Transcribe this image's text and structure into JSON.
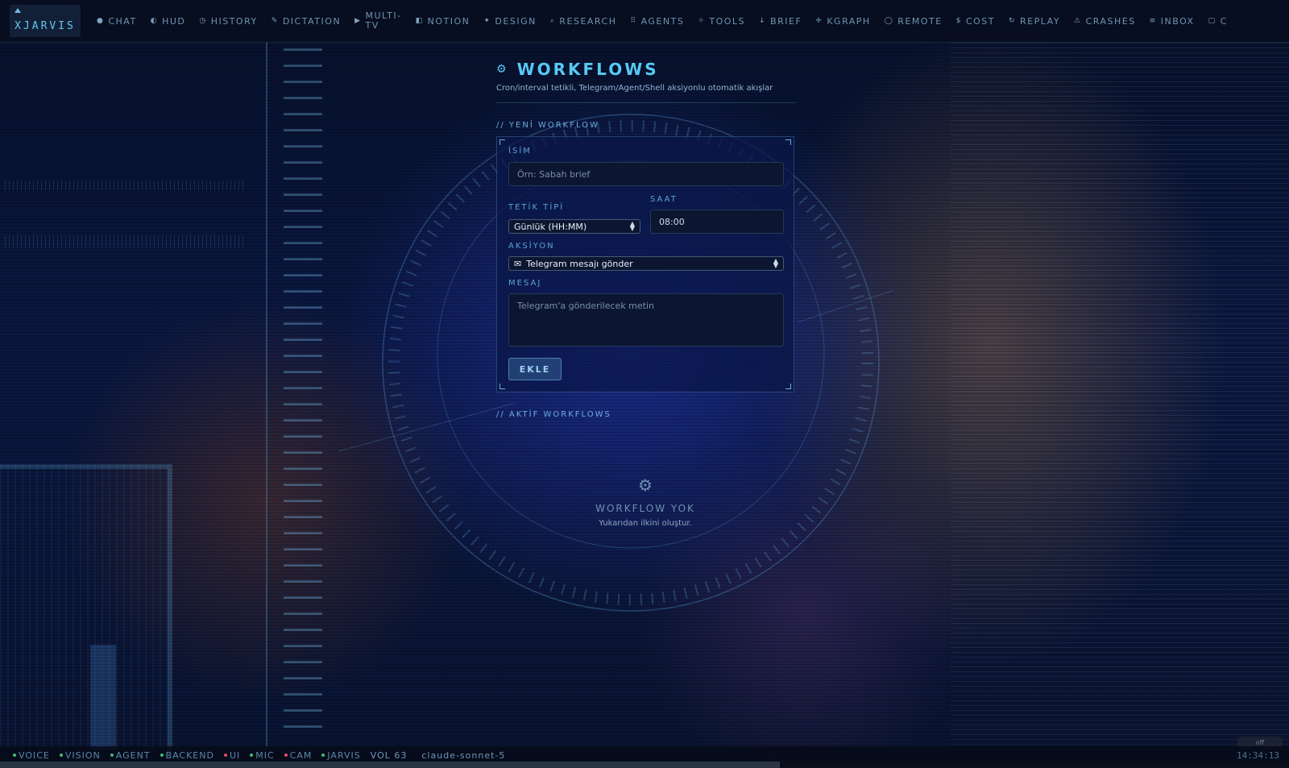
{
  "brand": {
    "label": "XJARVIS"
  },
  "nav": {
    "items": [
      {
        "icon": "chat-icon",
        "glyph": "●",
        "label": "CHAT"
      },
      {
        "icon": "hud-icon",
        "glyph": "◐",
        "label": "HUD"
      },
      {
        "icon": "history-icon",
        "glyph": "◷",
        "label": "HISTORY"
      },
      {
        "icon": "dictation-icon",
        "glyph": "✎",
        "label": "DICTATION"
      },
      {
        "icon": "multitv-icon",
        "glyph": "▶",
        "label": "MULTI-\nTV"
      },
      {
        "icon": "notion-icon",
        "glyph": "◧",
        "label": "NOTION"
      },
      {
        "icon": "design-icon",
        "glyph": "✦",
        "label": "DESIGN"
      },
      {
        "icon": "research-icon",
        "glyph": "⌕",
        "label": "RESEARCH"
      },
      {
        "icon": "agents-icon",
        "glyph": "⠿",
        "label": "AGENTS"
      },
      {
        "icon": "tools-icon",
        "glyph": "✧",
        "label": "TOOLS"
      },
      {
        "icon": "brief-icon",
        "glyph": "↓",
        "label": "BRIEF"
      },
      {
        "icon": "kgraph-icon",
        "glyph": "✛",
        "label": "KGRAPH"
      },
      {
        "icon": "remote-icon",
        "glyph": "◯",
        "label": "REMOTE"
      },
      {
        "icon": "cost-icon",
        "glyph": "$",
        "label": "COST"
      },
      {
        "icon": "replay-icon",
        "glyph": "↻",
        "label": "REPLAY"
      },
      {
        "icon": "crashes-icon",
        "glyph": "⚠",
        "label": "CRASHES"
      },
      {
        "icon": "inbox-icon",
        "glyph": "≡",
        "label": "INBOX"
      },
      {
        "icon": "overflow-icon",
        "glyph": "▢",
        "label": "C"
      }
    ]
  },
  "page": {
    "title": "WORKFLOWS",
    "subtitle": "Cron/interval tetikli, Telegram/Agent/Shell aksiyonlu otomatik akışlar"
  },
  "new_section": {
    "heading": "// YENİ WORKFLOW",
    "name_label": "İSİM",
    "name_placeholder": "Örn: Sabah brief",
    "name_value": "",
    "trigger_label": "TETİK TİPİ",
    "trigger_value": "Günlük (HH:MM)",
    "time_label": "SAAT",
    "time_value": "08:00",
    "action_label": "AKSİYON",
    "action_value": "Telegram mesajı gönder",
    "message_label": "MESAJ",
    "message_placeholder": "Telegram'a gönderilecek metin",
    "submit_label": "EKLE"
  },
  "active_section": {
    "heading": "// AKTİF WORKFLOWS",
    "empty_title": "WORKFLOW YOK",
    "empty_text": "Yukarıdan ilkini oluştur."
  },
  "status": {
    "items": [
      {
        "label": "VOICE",
        "color": "#3fbf6a"
      },
      {
        "label": "VISION",
        "color": "#3fbf6a"
      },
      {
        "label": "AGENT",
        "color": "#3fbf6a"
      },
      {
        "label": "BACKEND",
        "color": "#3fbf6a"
      },
      {
        "label": "UI",
        "color": "#e04a6a"
      },
      {
        "label": "MIC",
        "color": "#3fbf6a"
      },
      {
        "label": "CAM",
        "color": "#e04a6a"
      },
      {
        "label": "JARVIS",
        "color": "#3fbf6a"
      }
    ],
    "volume": "VOL 63",
    "model": "claude-sonnet-5",
    "time": "14:34:13",
    "widget_text": "off",
    "progress_fraction": 0.605
  },
  "theme": {
    "accent": "#58c8f4",
    "ok": "#3fbf6a",
    "error": "#e04a6a"
  }
}
